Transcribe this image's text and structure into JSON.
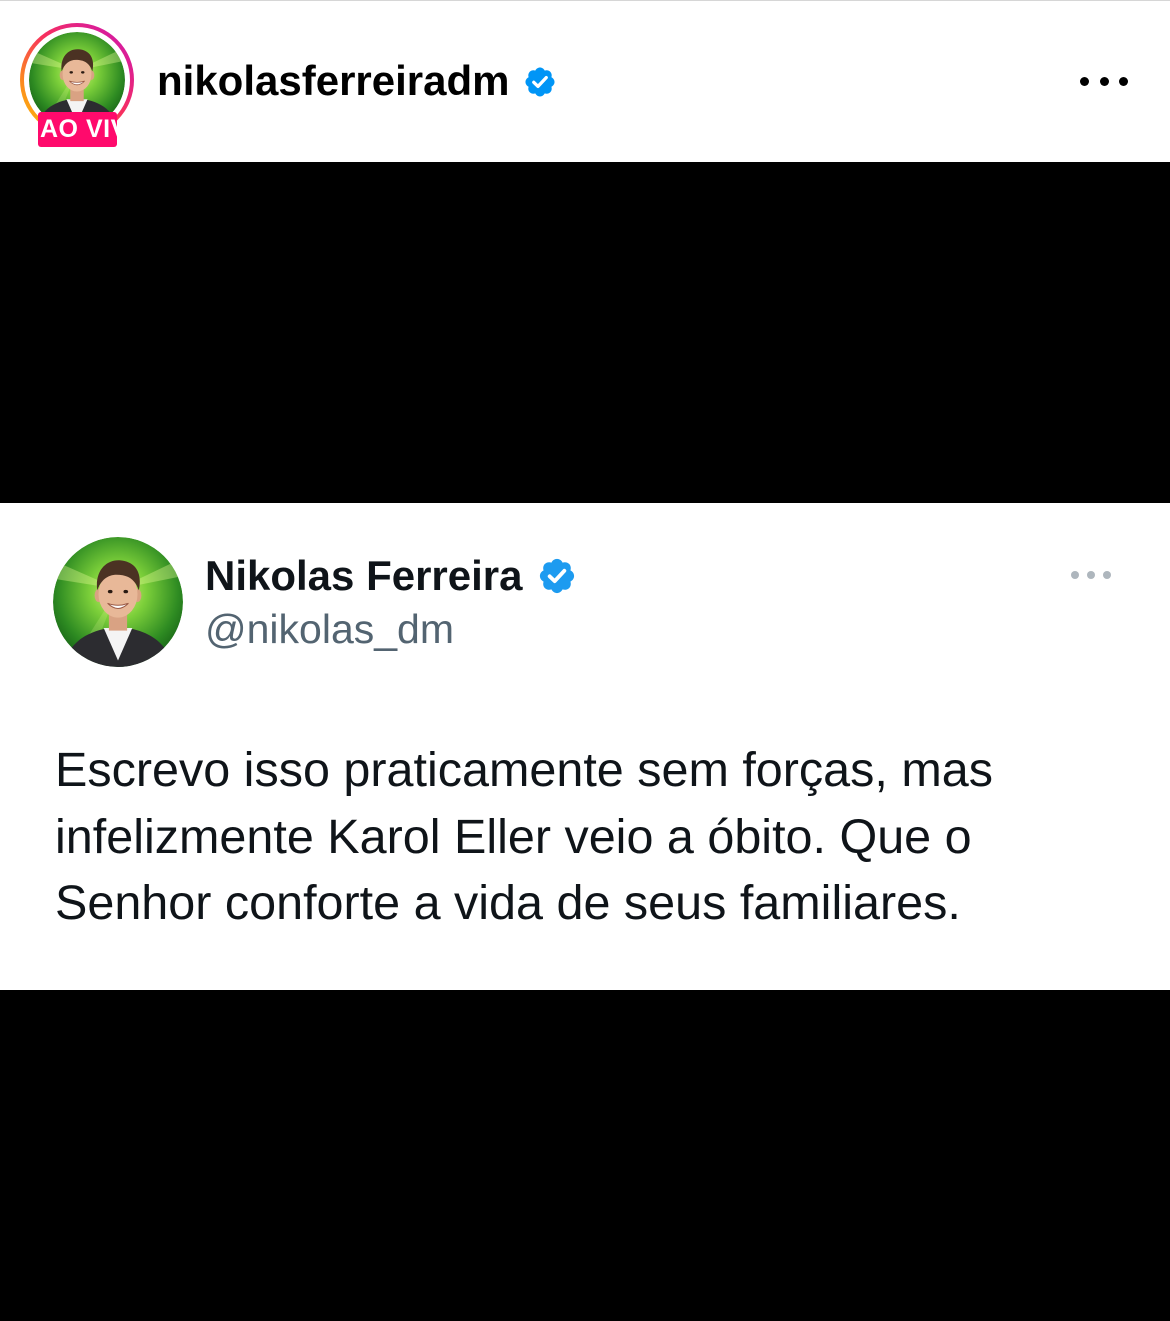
{
  "post_header": {
    "username": "nikolasferreiradm",
    "live_badge": "AO VIV",
    "verified_icon": "verified-badge-icon",
    "more_icon": "more-options-icon"
  },
  "tweet": {
    "display_name": "Nikolas Ferreira",
    "handle": "@nikolas_dm",
    "verified_icon": "verified-badge-icon",
    "more_icon": "more-options-icon",
    "text_lines": [
      "Escrevo isso praticamente sem forças, mas",
      "infelizmente Karol Eller veio a óbito. Que o",
      "Senhor conforte a vida de seus familiares."
    ]
  },
  "colors": {
    "instagram_verified": "#0095f6",
    "twitter_verified": "#1d9bf0",
    "live_badge": "#ff0a6c",
    "media_background": "#000000",
    "tweet_handle": "#536471",
    "tweet_text": "#0f1419"
  }
}
